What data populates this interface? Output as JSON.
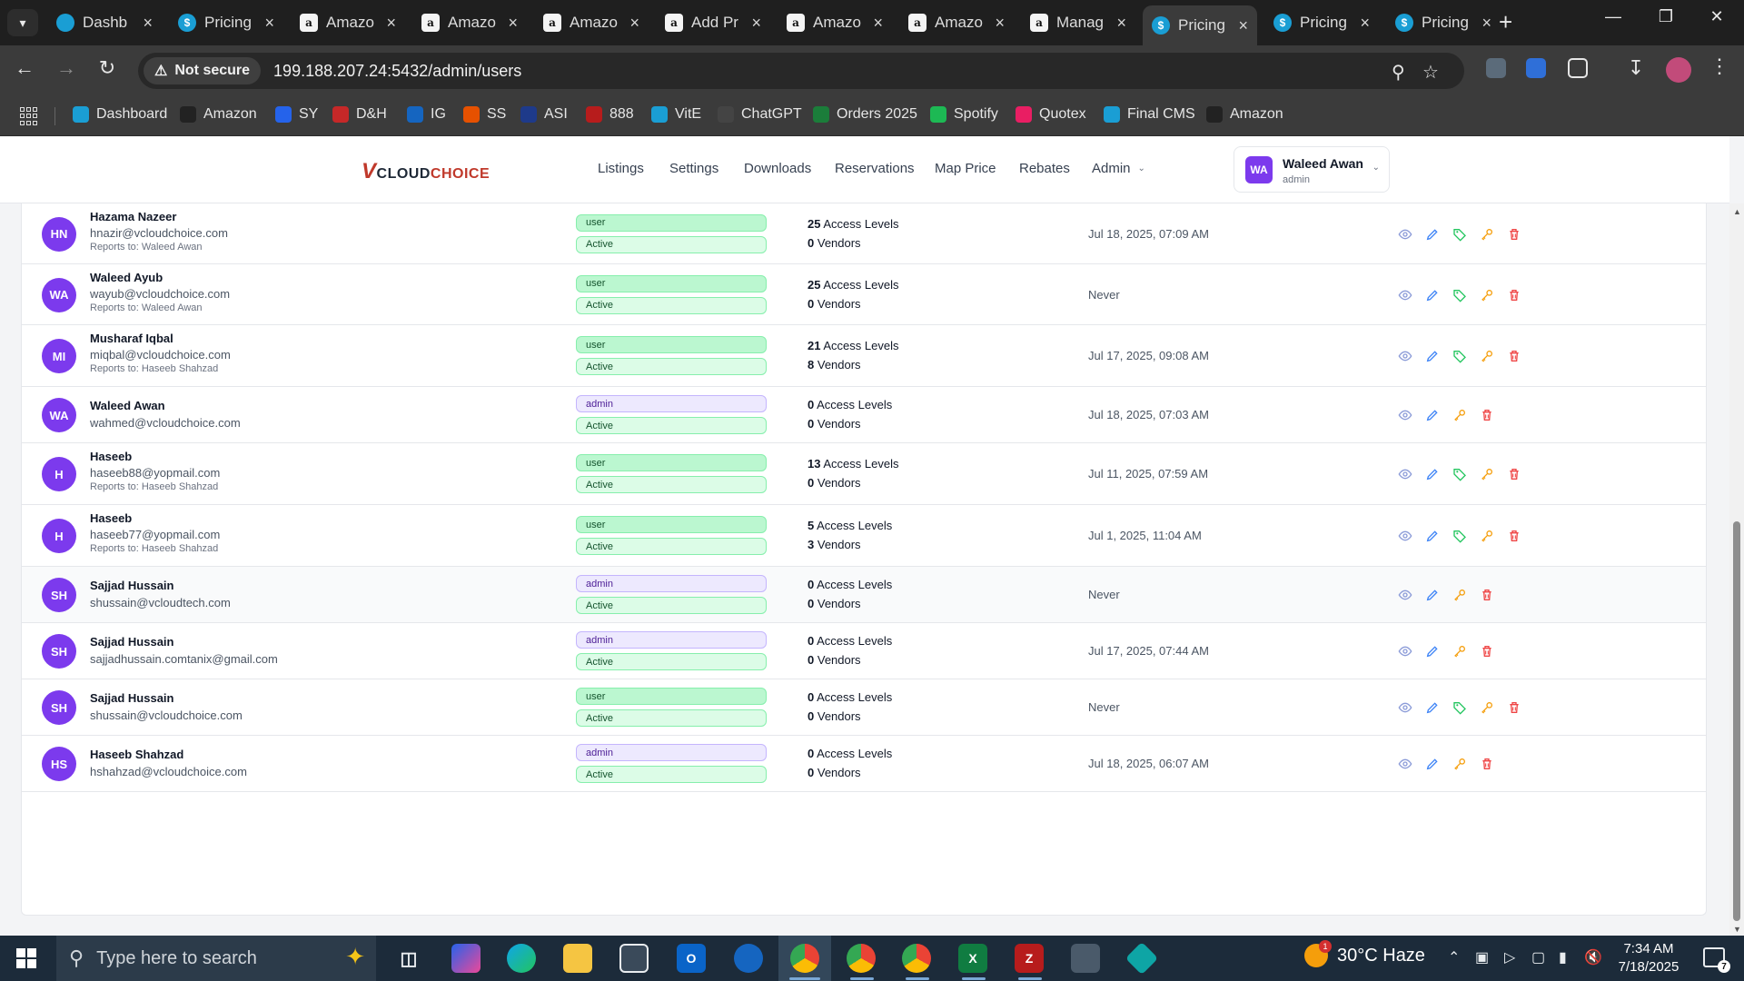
{
  "browser": {
    "tabs": [
      {
        "title": "Dashb",
        "icon": "dashboard-icon"
      },
      {
        "title": "Pricing",
        "icon": "dollar-icon"
      },
      {
        "title": "Amazo",
        "icon": "amazon-icon"
      },
      {
        "title": "Amazo",
        "icon": "amazon-icon"
      },
      {
        "title": "Amazo",
        "icon": "amazon-icon"
      },
      {
        "title": "Add Pr",
        "icon": "amazon-icon"
      },
      {
        "title": "Amazo",
        "icon": "amazon-icon"
      },
      {
        "title": "Amazo",
        "icon": "amazon-icon"
      },
      {
        "title": "Manag",
        "icon": "amazon-icon"
      },
      {
        "title": "Pricing",
        "icon": "dollar-icon",
        "active": true
      },
      {
        "title": "Pricing",
        "icon": "dollar-icon"
      },
      {
        "title": "Pricing",
        "icon": "dollar-icon"
      }
    ],
    "security_label": "Not secure",
    "url": "199.188.207.24:5432/admin/users",
    "bookmarks": [
      {
        "label": "Dashboard",
        "color": "#1a9ed4"
      },
      {
        "label": "Amazon",
        "color": "#222222"
      },
      {
        "label": "SY",
        "color": "#2563eb"
      },
      {
        "label": "D&H",
        "color": "#c62828"
      },
      {
        "label": "IG",
        "color": "#1565c0"
      },
      {
        "label": "SS",
        "color": "#e65100"
      },
      {
        "label": "ASI",
        "color": "#1e3a8a"
      },
      {
        "label": "888",
        "color": "#b71c1c"
      },
      {
        "label": "VitE",
        "color": "#1a9ed4"
      },
      {
        "label": "ChatGPT",
        "color": "#444444"
      },
      {
        "label": "Orders 2025",
        "color": "#1b7d3a"
      },
      {
        "label": "Spotify",
        "color": "#1db954"
      },
      {
        "label": "Quotex",
        "color": "#e91e63"
      },
      {
        "label": "Final CMS",
        "color": "#1a9ed4"
      },
      {
        "label": "Amazon",
        "color": "#222222"
      }
    ]
  },
  "app": {
    "logo": {
      "v": "V",
      "cloud": "CLOUD",
      "choice": "CHOICE"
    },
    "nav": [
      "Listings",
      "Settings",
      "Downloads",
      "Reservations",
      "Map Price",
      "Rebates"
    ],
    "admin_menu": "Admin",
    "user": {
      "initials": "WA",
      "name": "Waleed Awan",
      "role": "admin"
    }
  },
  "users": [
    {
      "initials": "HN",
      "name": "Hazama Nazeer",
      "email": "hnazir@vcloudchoice.com",
      "reports_to": "Reports to: Waleed Awan",
      "role": "user",
      "status": "Active",
      "access_count": "25",
      "access_label": "Access Levels",
      "vendor_count": "0",
      "vendor_label": "Vendors",
      "last_login": "Jul 18, 2025, 07:09 AM"
    },
    {
      "initials": "WA",
      "name": "Waleed Ayub",
      "email": "wayub@vcloudchoice.com",
      "reports_to": "Reports to: Waleed Awan",
      "role": "user",
      "status": "Active",
      "access_count": "25",
      "access_label": "Access Levels",
      "vendor_count": "0",
      "vendor_label": "Vendors",
      "last_login": "Never"
    },
    {
      "initials": "MI",
      "name": "Musharaf Iqbal",
      "email": "miqbal@vcloudchoice.com",
      "reports_to": "Reports to: Haseeb Shahzad",
      "role": "user",
      "status": "Active",
      "access_count": "21",
      "access_label": "Access Levels",
      "vendor_count": "8",
      "vendor_label": "Vendors",
      "last_login": "Jul 17, 2025, 09:08 AM"
    },
    {
      "initials": "WA",
      "name": "Waleed Awan",
      "email": "wahmed@vcloudchoice.com",
      "reports_to": "",
      "role": "admin",
      "status": "Active",
      "access_count": "0",
      "access_label": "Access Levels",
      "vendor_count": "0",
      "vendor_label": "Vendors",
      "last_login": "Jul 18, 2025, 07:03 AM"
    },
    {
      "initials": "H",
      "name": "Haseeb",
      "email": "haseeb88@yopmail.com",
      "reports_to": "Reports to: Haseeb Shahzad",
      "role": "user",
      "status": "Active",
      "access_count": "13",
      "access_label": "Access Levels",
      "vendor_count": "0",
      "vendor_label": "Vendors",
      "last_login": "Jul 11, 2025, 07:59 AM"
    },
    {
      "initials": "H",
      "name": "Haseeb",
      "email": "haseeb77@yopmail.com",
      "reports_to": "Reports to: Haseeb Shahzad",
      "role": "user",
      "status": "Active",
      "access_count": "5",
      "access_label": "Access Levels",
      "vendor_count": "3",
      "vendor_label": "Vendors",
      "last_login": "Jul 1, 2025, 11:04 AM"
    },
    {
      "initials": "SH",
      "name": "Sajjad Hussain",
      "email": "shussain@vcloudtech.com",
      "reports_to": "",
      "role": "admin",
      "status": "Active",
      "access_count": "0",
      "access_label": "Access Levels",
      "vendor_count": "0",
      "vendor_label": "Vendors",
      "last_login": "Never"
    },
    {
      "initials": "SH",
      "name": "Sajjad Hussain",
      "email": "sajjadhussain.comtanix@gmail.com",
      "reports_to": "",
      "role": "admin",
      "status": "Active",
      "access_count": "0",
      "access_label": "Access Levels",
      "vendor_count": "0",
      "vendor_label": "Vendors",
      "last_login": "Jul 17, 2025, 07:44 AM"
    },
    {
      "initials": "SH",
      "name": "Sajjad Hussain",
      "email": "shussain@vcloudchoice.com",
      "reports_to": "",
      "role": "user",
      "status": "Active",
      "access_count": "0",
      "access_label": "Access Levels",
      "vendor_count": "0",
      "vendor_label": "Vendors",
      "last_login": "Never"
    },
    {
      "initials": "HS",
      "name": "Haseeb Shahzad",
      "email": "hshahzad@vcloudchoice.com",
      "reports_to": "",
      "role": "admin",
      "status": "Active",
      "access_count": "0",
      "access_label": "Access Levels",
      "vendor_count": "0",
      "vendor_label": "Vendors",
      "last_login": "Jul 18, 2025, 06:07 AM"
    }
  ],
  "colors": {
    "avatar": "#7c3aed",
    "view": "#8b9bd8",
    "edit": "#3b82f6",
    "tag": "#22c55e",
    "key": "#f59e0b",
    "delete": "#ef4444"
  },
  "taskbar": {
    "search_placeholder": "Type here to search",
    "weather": "30°C  Haze",
    "weather_badge": "1",
    "time": "7:34 AM",
    "date": "7/18/2025",
    "notification_count": "7"
  }
}
